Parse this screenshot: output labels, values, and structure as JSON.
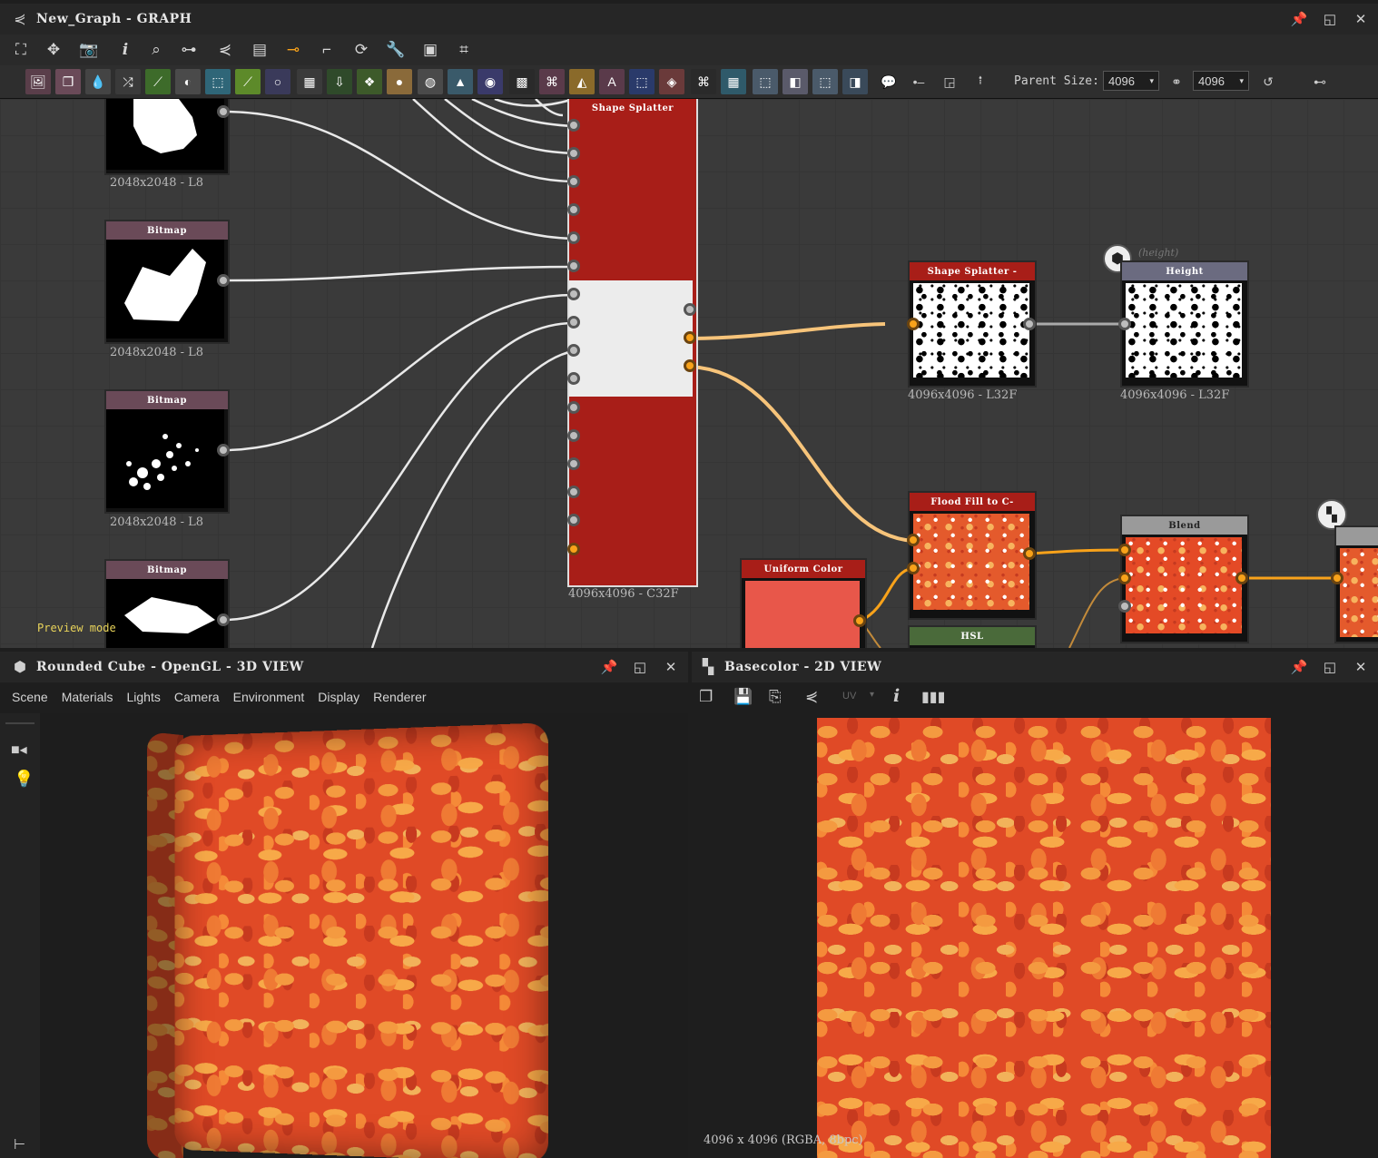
{
  "graph_panel": {
    "title": "New_Graph - GRAPH",
    "preview_mode": "Preview mode"
  },
  "toolbar": {
    "parent_size_label": "Parent Size:",
    "parent_width": "4096",
    "parent_height": "4096"
  },
  "nodes": {
    "bitmap_1": {
      "label": "2048x2048 - L8"
    },
    "bitmap_2": {
      "title": "Bitmap",
      "label": "2048x2048 - L8"
    },
    "bitmap_3": {
      "title": "Bitmap",
      "label": "2048x2048 - L8"
    },
    "bitmap_4": {
      "title": "Bitmap"
    },
    "shape_splatter_main": {
      "title": "Shape Splatter",
      "label": "4096x4096 - C32F"
    },
    "shape_splatter_out": {
      "title": "Shape Splatter -",
      "label": "4096x4096 - L32F"
    },
    "height": {
      "title": "Height",
      "label": "4096x4096 - L32F",
      "tag": "(height)"
    },
    "flood_fill": {
      "title": "Flood Fill to C-"
    },
    "uniform_color": {
      "title": "Uniform Color",
      "color": "#e8574a"
    },
    "hsl": {
      "title": "HSL"
    },
    "blend": {
      "title": "Blend"
    }
  },
  "view3d": {
    "title": "Rounded Cube - OpenGL - 3D VIEW",
    "menu": [
      "Scene",
      "Materials",
      "Lights",
      "Camera",
      "Environment",
      "Display",
      "Renderer"
    ]
  },
  "view2d": {
    "title": "Basecolor - 2D VIEW",
    "uv_label": "UV",
    "status": "4096 x 4096 (RGBA, 8bpc)"
  },
  "colors": {
    "node_red": "#a81e18",
    "bitmap_header": "#6a4a58",
    "port_orange": "#f8a21a",
    "wire_orange": "#f7c47a"
  }
}
